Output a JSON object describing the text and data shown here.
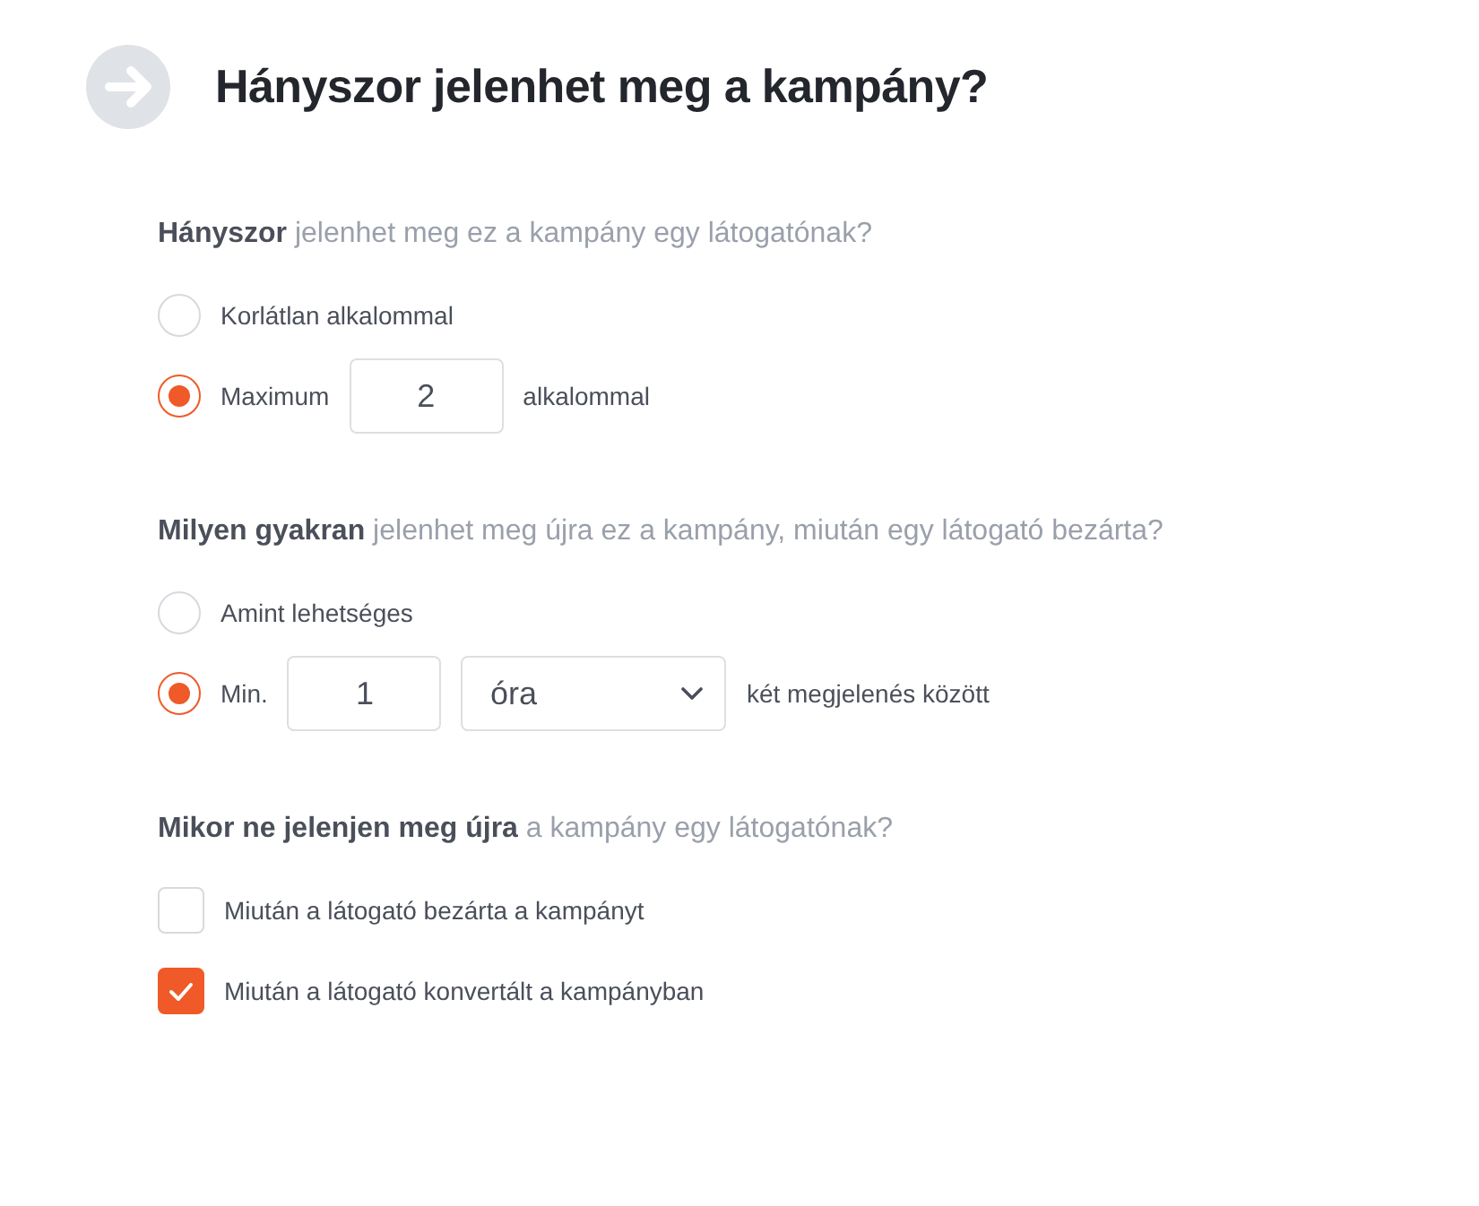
{
  "header": {
    "title": "Hányszor jelenhet meg a kampány?"
  },
  "sections": [
    {
      "question": "**Hányszor** jelenhet meg ez a kampány egy látogatónak?",
      "options": [
        {
          "kind": "radio",
          "selected": false,
          "parts": [
            {
              "kind": "text",
              "text": "Korlátlan alkalommal"
            }
          ]
        },
        {
          "kind": "radio",
          "selected": true,
          "parts": [
            {
              "kind": "text",
              "text": "Maximum"
            },
            {
              "kind": "input",
              "value": "2"
            },
            {
              "kind": "text",
              "text": "alkalommal"
            }
          ]
        }
      ]
    },
    {
      "question": "**Milyen gyakran** jelenhet meg újra ez a kampány, miután egy látogató bezárta?",
      "options": [
        {
          "kind": "radio",
          "selected": false,
          "parts": [
            {
              "kind": "text",
              "text": "Amint lehetséges"
            }
          ]
        },
        {
          "kind": "radio",
          "selected": true,
          "parts": [
            {
              "kind": "text",
              "text": "Min."
            },
            {
              "kind": "input",
              "value": "1"
            },
            {
              "kind": "select",
              "value": "óra"
            },
            {
              "kind": "text",
              "text": "két megjelenés között"
            }
          ]
        }
      ]
    },
    {
      "question": "**Mikor ne jelenjen meg újra** a kampány egy látogatónak?",
      "options": [
        {
          "kind": "checkbox",
          "checked": false,
          "parts": [
            {
              "kind": "text",
              "text": "Miután a látogató bezárta a kampányt"
            }
          ]
        },
        {
          "kind": "checkbox",
          "checked": true,
          "parts": [
            {
              "kind": "text",
              "text": "Miután a látogató konvertált a kampányban"
            }
          ]
        }
      ]
    }
  ]
}
